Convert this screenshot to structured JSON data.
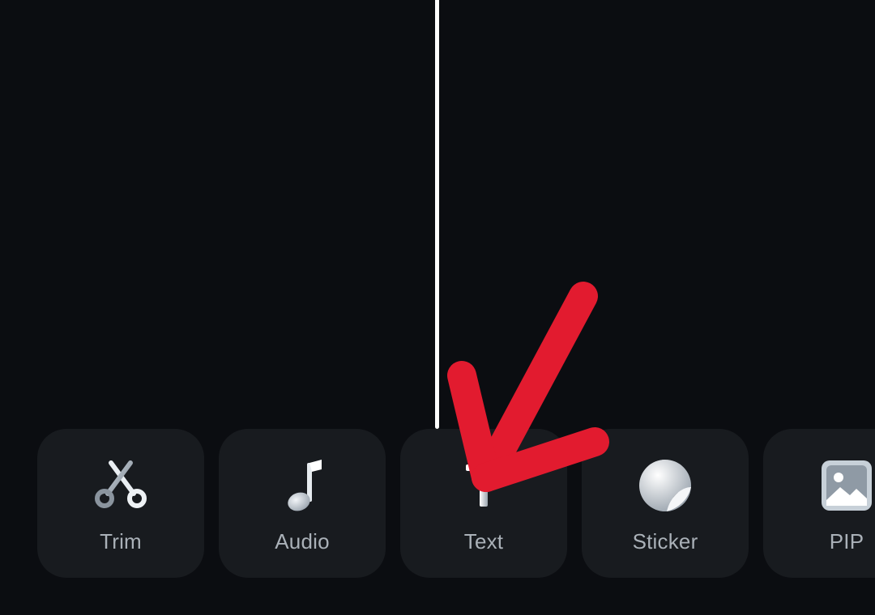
{
  "toolbar": {
    "tools": [
      {
        "label": "Trim",
        "icon": "scissors-icon"
      },
      {
        "label": "Audio",
        "icon": "music-note-icon"
      },
      {
        "label": "Text",
        "icon": "text-icon"
      },
      {
        "label": "Sticker",
        "icon": "sticker-icon"
      },
      {
        "label": "PIP",
        "icon": "image-icon"
      }
    ]
  },
  "annotation": {
    "arrow_color": "#e21b2f",
    "points_to": "Text"
  },
  "colors": {
    "background": "#0b0d11",
    "tile": "#181b1f",
    "label": "#aab1b8",
    "playhead": "#ffffff"
  }
}
